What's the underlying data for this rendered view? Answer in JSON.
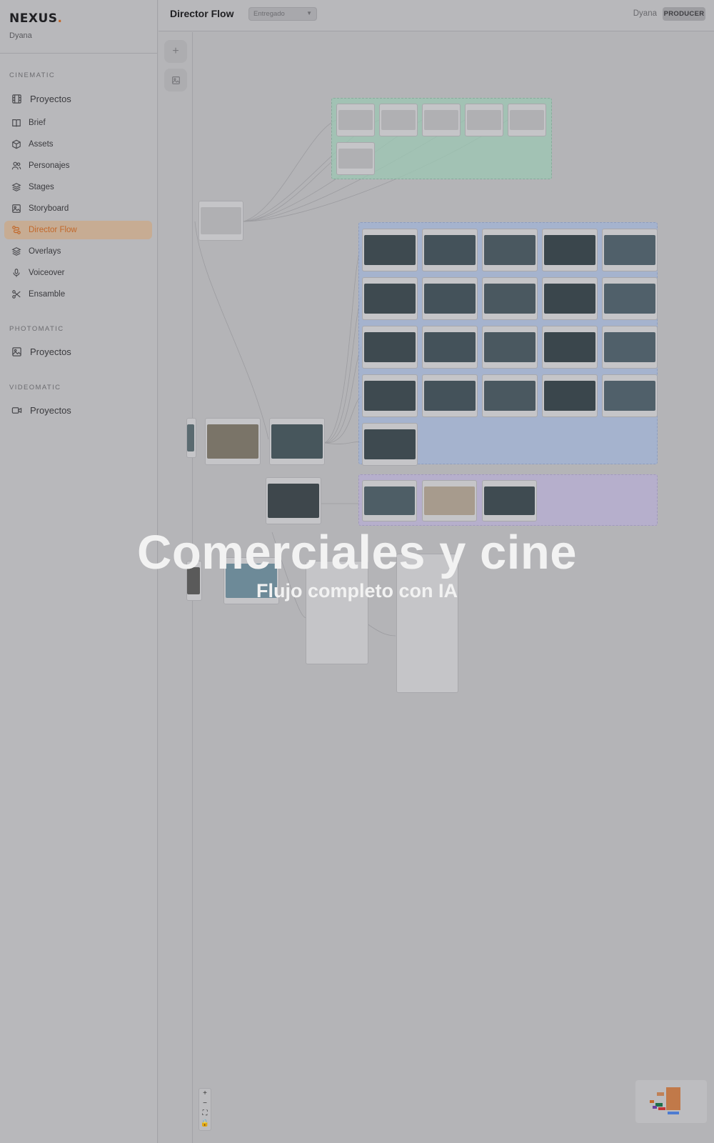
{
  "app": {
    "brand": "NEXUS",
    "brand_dot": ".",
    "user_subtitle": "Dyana"
  },
  "sidebar": {
    "sections": [
      {
        "label": "CINEMATIC"
      },
      {
        "label": "PHOTOMATIC"
      },
      {
        "label": "VIDEOMATIC"
      }
    ],
    "cinematic_items": [
      {
        "label": "Proyectos",
        "icon": "film-icon"
      },
      {
        "label": "Brief",
        "icon": "book-icon"
      },
      {
        "label": "Assets",
        "icon": "package-icon"
      },
      {
        "label": "Personajes",
        "icon": "users-icon"
      },
      {
        "label": "Stages",
        "icon": "layers-icon"
      },
      {
        "label": "Storyboard",
        "icon": "image-icon"
      },
      {
        "label": "Director Flow",
        "icon": "route-icon",
        "active": true
      },
      {
        "label": "Overlays",
        "icon": "layers-icon"
      },
      {
        "label": "Voiceover",
        "icon": "mic-icon"
      },
      {
        "label": "Ensamble",
        "icon": "scissors-icon"
      }
    ],
    "photomatic_items": [
      {
        "label": "Proyectos",
        "icon": "image-icon"
      }
    ],
    "videomatic_items": [
      {
        "label": "Proyectos",
        "icon": "video-icon"
      }
    ]
  },
  "header": {
    "title": "Director Flow",
    "status": "Entregado",
    "user": "Dyana",
    "role": "PRODUCER"
  },
  "toolrail": {
    "add_icon": "plus-icon",
    "image_icon": "image-icon"
  },
  "zoom": {
    "in": "+",
    "out": "−",
    "fit": "⛶",
    "lock": "🔒"
  },
  "overlay": {
    "title": "Comerciales y cine",
    "subtitle": "Flujo completo con IA"
  },
  "colors": {
    "accent": "#c2682b",
    "group_green": "#9cc7b3",
    "group_blue": "#9fb3d8",
    "group_purple": "#b8aed6"
  }
}
